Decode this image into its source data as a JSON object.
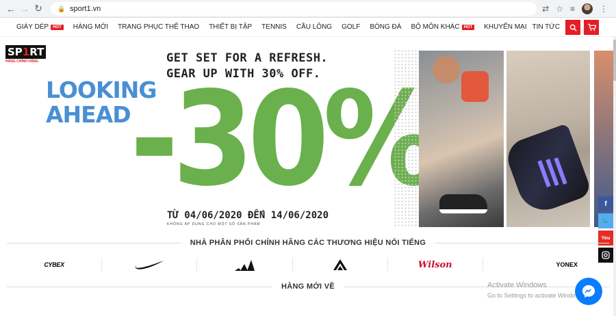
{
  "browser": {
    "url": "sport1.vn",
    "icons": [
      "back-icon",
      "forward-icon",
      "reload-icon",
      "lock-icon",
      "translate-icon",
      "star-icon",
      "reading-list-icon",
      "profile-avatar",
      "more-icon"
    ]
  },
  "menu": {
    "items": [
      {
        "label": "GIÀY DÉP",
        "hot": "HOT"
      },
      {
        "label": "HÀNG MỚI"
      },
      {
        "label": "TRANG PHỤC THỂ THAO"
      },
      {
        "label": "THIẾT BỊ TẬP"
      },
      {
        "label": "TENNIS"
      },
      {
        "label": "CẦU LÔNG"
      },
      {
        "label": "GOLF"
      },
      {
        "label": "BÓNG ĐÁ"
      },
      {
        "label": "BỘ MÔN KHÁC",
        "hot": "HOT"
      },
      {
        "label": "KHUYẾN MẠI"
      },
      {
        "label": "TIN TỨC"
      }
    ],
    "search_icon": "search-icon",
    "cart_icon": "cart-icon"
  },
  "logo": {
    "text_a": "SP",
    "text_b": "1",
    "text_c": "RT",
    "sub": "HÀNG CHÍNH HÃNG"
  },
  "banner": {
    "tagline_line1": "GET SET FOR A REFRESH.",
    "tagline_line2": "GEAR UP WITH 30% OFF.",
    "looking_line1": "LOOKING",
    "looking_line2": "AHEAD",
    "discount": "-30%",
    "dates": "TỪ 04/06/2020 ĐẾN 14/06/2020",
    "fine_print": "KHÔNG ÁP DỤNG CHO MỘT SỐ SẢN PHẨM"
  },
  "social": {
    "facebook": "f",
    "twitter": "t",
    "youtube": "You",
    "instagram": "ig"
  },
  "brands_section": {
    "title": "NHÀ PHÂN PHỐI CHÍNH HÃNG CÁC THƯƠNG HIỆU NỔI TIẾNG",
    "brands": [
      "CYBEX",
      "Nike",
      "adidas",
      "Arcteryx",
      "Wilson",
      "YONEX"
    ]
  },
  "cybex_label": "CYBEX",
  "wilson_label": "Wilson",
  "yonex_label": "YONEX",
  "new_section": {
    "title": "HÀNG MỚI VỀ"
  },
  "watermark": {
    "line1": "Activate Windows",
    "line2": "Go to Settings to activate Windows."
  },
  "colors": {
    "brand_red": "#e41e26",
    "discount_green": "#6ab04c",
    "looking_blue": "#4a8fd3",
    "messenger_blue": "#0a7cff"
  }
}
